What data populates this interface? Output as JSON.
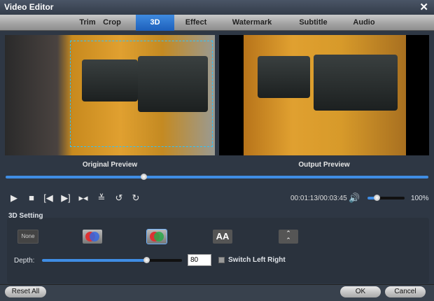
{
  "window": {
    "title": "Video Editor"
  },
  "tabs": [
    {
      "label": "Trim"
    },
    {
      "label": "Crop"
    },
    {
      "label": "3D",
      "active": true
    },
    {
      "label": "Effect"
    },
    {
      "label": "Watermark"
    },
    {
      "label": "Subtitle"
    },
    {
      "label": "Audio"
    }
  ],
  "preview": {
    "original_label": "Original Preview",
    "output_label": "Output Preview"
  },
  "playback": {
    "time": "00:01:13/00:03:45",
    "progress_fraction": 0.32,
    "volume_label": "100%"
  },
  "settings": {
    "title": "3D Setting",
    "modes": [
      {
        "name": "none",
        "label": "None"
      },
      {
        "name": "anaglyph-red-blue"
      },
      {
        "name": "anaglyph-red-green",
        "selected": true
      },
      {
        "name": "side-by-side",
        "label": "AA"
      },
      {
        "name": "top-bottom"
      }
    ],
    "depth_label": "Depth:",
    "depth_value": "80",
    "switch_label": "Switch Left Right",
    "switch_checked": false
  },
  "buttons": {
    "reset": "Reset All",
    "ok": "OK",
    "cancel": "Cancel"
  },
  "colors": {
    "accent": "#3f8de4",
    "bg": "#2e3744"
  }
}
